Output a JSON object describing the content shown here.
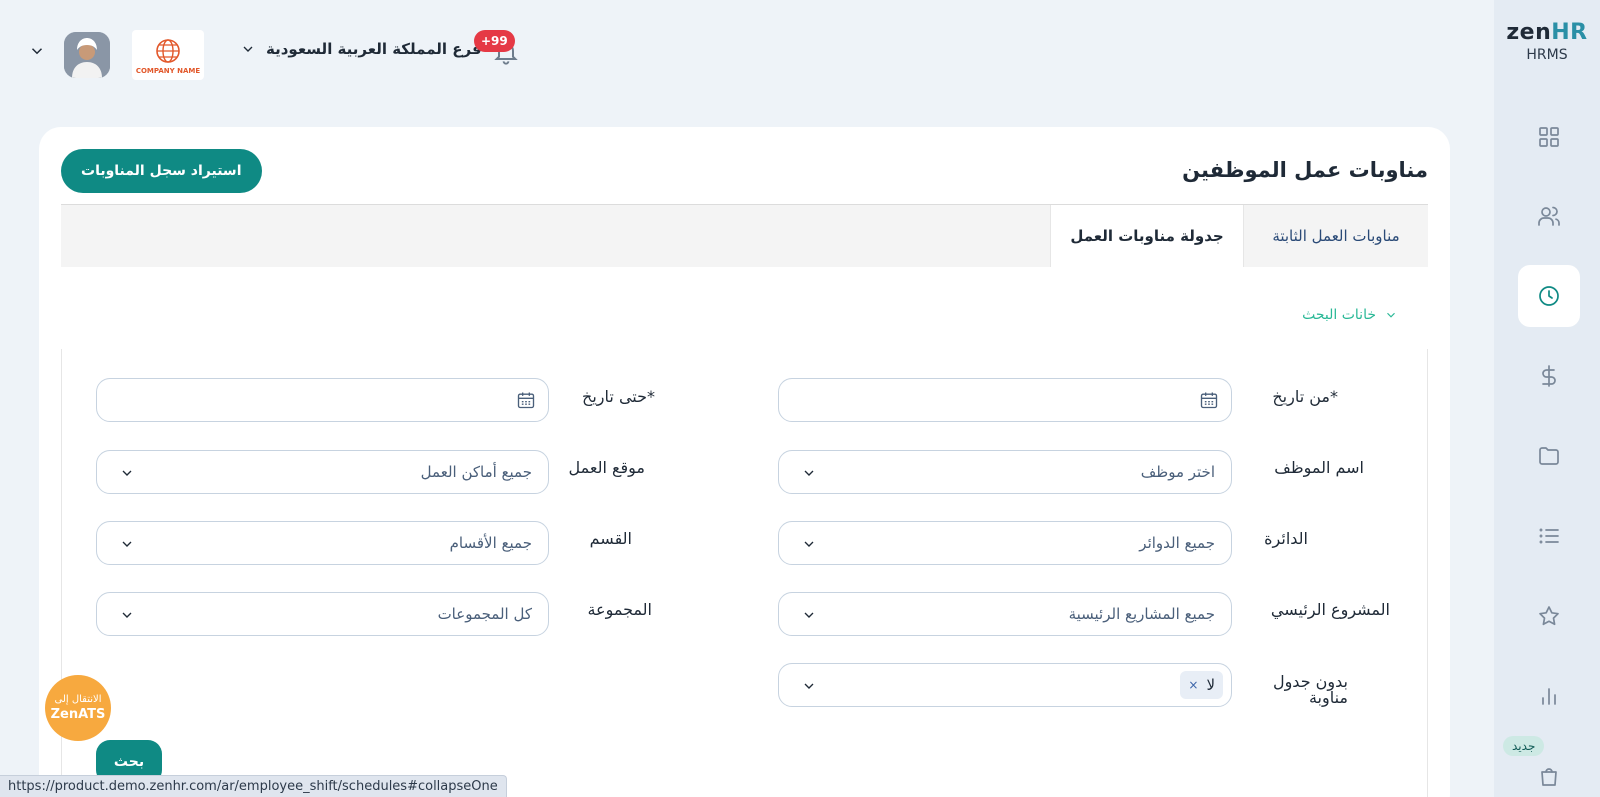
{
  "brand": {
    "logo_main": "zen",
    "logo_accent": "HR",
    "subtitle": "HRMS"
  },
  "sidebar": {
    "items": [
      {
        "icon": "dashboard-grid-icon"
      },
      {
        "icon": "users-icon"
      },
      {
        "icon": "clock-icon",
        "active": true
      },
      {
        "icon": "dollar-icon"
      },
      {
        "icon": "folder-icon"
      },
      {
        "icon": "list-icon"
      },
      {
        "icon": "star-icon"
      },
      {
        "icon": "bar-chart-icon"
      },
      {
        "icon": "shopping-bag-icon"
      }
    ],
    "new_badge": "جديد"
  },
  "header": {
    "company_logo_text": "COMPANY NAME",
    "branch": "فرع المملكة العربية السعودية",
    "notifications_count": "+99"
  },
  "page": {
    "title": "مناوبات عمل الموظفين",
    "import_button": "استيراد سجل المناوبات"
  },
  "tabs": [
    {
      "label": "مناوبات العمل الثابتة",
      "active": false
    },
    {
      "label": "جدولة مناوبات العمل",
      "active": true
    }
  ],
  "search_toggle": "خانات البحث",
  "filters": {
    "from_date": {
      "label": "من تاريخ",
      "required": "*",
      "value": ""
    },
    "to_date": {
      "label": "حتى تاريخ",
      "required": "*",
      "value": ""
    },
    "employee_name": {
      "label": "اسم الموظف",
      "value": "اختر موظف"
    },
    "work_location": {
      "label": "موقع العمل",
      "value": "جميع أماكن العمل"
    },
    "department": {
      "label": "الدائرة",
      "value": "جميع الدوائر"
    },
    "section": {
      "label": "القسم",
      "value": "جميع الأقسام"
    },
    "main_project": {
      "label": "المشروع الرئيسي",
      "value": "جميع المشاريع الرئيسية"
    },
    "group": {
      "label": "المجموعة",
      "value": "كل المجموعات"
    },
    "no_schedule": {
      "label_line1": "بدون جدول",
      "label_line2": "مناوبة",
      "tag_value": "لا",
      "tag_remove": "×"
    }
  },
  "search_button": "بحث",
  "ats_button": {
    "line1": "الانتقال إلى",
    "line2": "ZenATS"
  },
  "status_url": "https://product.demo.zenhr.com/ar/employee_shift/schedules#collapseOne",
  "colors": {
    "primary": "#0f8a84",
    "accent_green": "#29b896",
    "badge_red": "#e53945",
    "ats_orange": "#f7a93f"
  }
}
